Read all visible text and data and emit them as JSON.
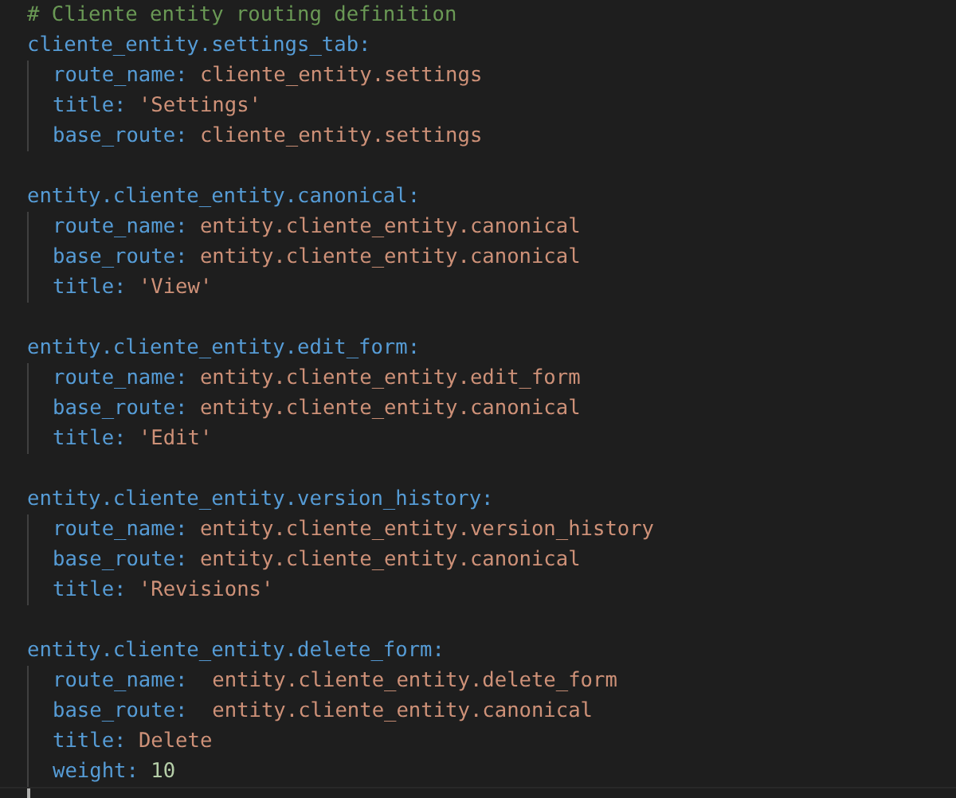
{
  "comment": "# Cliente entity routing definition",
  "blocks": [
    {
      "key": "cliente_entity.settings_tab:",
      "children": [
        {
          "key": "route_name:",
          "value": " cliente_entity.settings",
          "kind": "string"
        },
        {
          "key": "title:",
          "value": " 'Settings'",
          "kind": "string"
        },
        {
          "key": "base_route:",
          "value": " cliente_entity.settings",
          "kind": "string"
        }
      ]
    },
    {
      "key": "entity.cliente_entity.canonical:",
      "children": [
        {
          "key": "route_name:",
          "value": " entity.cliente_entity.canonical",
          "kind": "string"
        },
        {
          "key": "base_route:",
          "value": " entity.cliente_entity.canonical",
          "kind": "string"
        },
        {
          "key": "title:",
          "value": " 'View'",
          "kind": "string"
        }
      ]
    },
    {
      "key": "entity.cliente_entity.edit_form:",
      "children": [
        {
          "key": "route_name:",
          "value": " entity.cliente_entity.edit_form",
          "kind": "string"
        },
        {
          "key": "base_route:",
          "value": " entity.cliente_entity.canonical",
          "kind": "string"
        },
        {
          "key": "title:",
          "value": " 'Edit'",
          "kind": "string"
        }
      ]
    },
    {
      "key": "entity.cliente_entity.version_history:",
      "children": [
        {
          "key": "route_name:",
          "value": " entity.cliente_entity.version_history",
          "kind": "string"
        },
        {
          "key": "base_route:",
          "value": " entity.cliente_entity.canonical",
          "kind": "string"
        },
        {
          "key": "title:",
          "value": " 'Revisions'",
          "kind": "string"
        }
      ]
    },
    {
      "key": "entity.cliente_entity.delete_form:",
      "children": [
        {
          "key": "route_name:",
          "value": "  entity.cliente_entity.delete_form",
          "kind": "string"
        },
        {
          "key": "base_route:",
          "value": "  entity.cliente_entity.canonical",
          "kind": "string"
        },
        {
          "key": "title:",
          "value": " Delete",
          "kind": "string"
        },
        {
          "key": "weight:",
          "value": " 10",
          "kind": "number"
        }
      ]
    }
  ]
}
